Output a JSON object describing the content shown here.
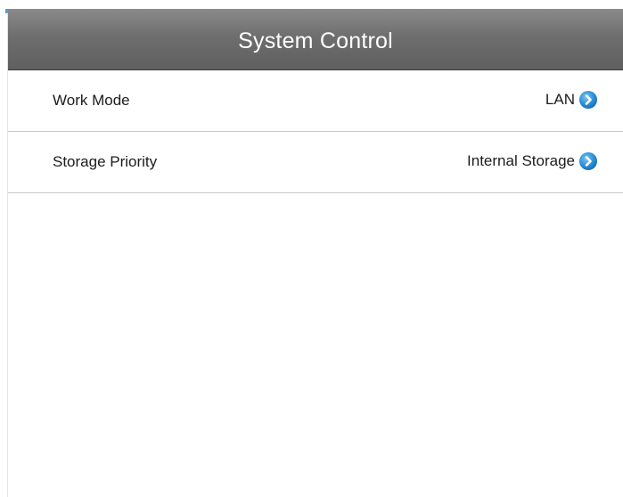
{
  "header": {
    "title": "System Control"
  },
  "settings": [
    {
      "label": "Work Mode",
      "value": "LAN",
      "icon": "chevron-right-circle-icon"
    },
    {
      "label": "Storage Priority",
      "value": "Internal Storage",
      "icon": "chevron-right-circle-icon"
    }
  ],
  "colors": {
    "header_background": "#6e6e6e",
    "accent_blue": "#2b8fd6",
    "divider": "#c8c8c8"
  }
}
